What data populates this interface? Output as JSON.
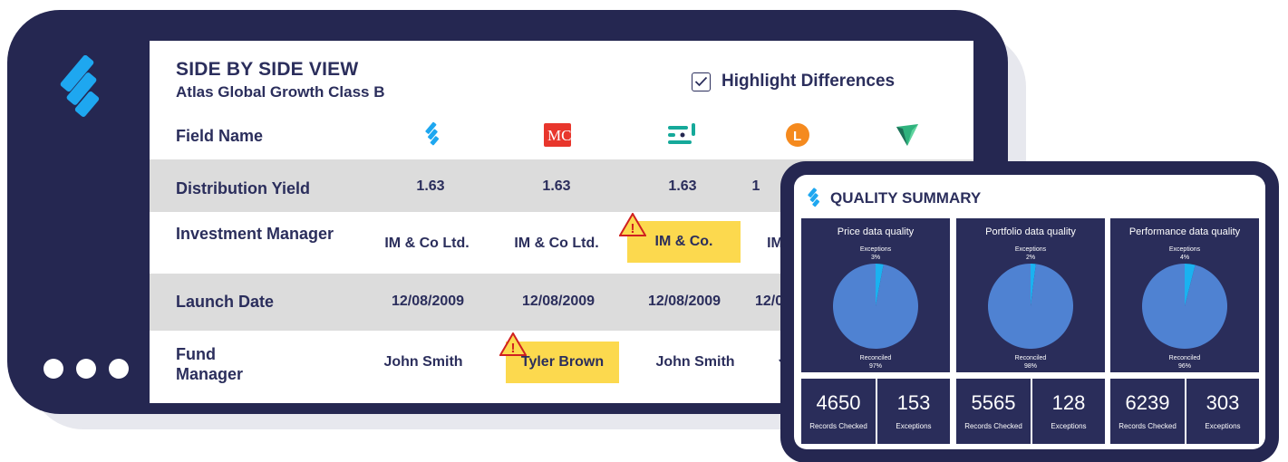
{
  "header": {
    "title": "SIDE BY SIDE VIEW",
    "subtitle": "Atlas Global Growth Class B",
    "highlight_label": "Highlight Differences",
    "highlight_checked": true,
    "field_name_label": "Field Name"
  },
  "sources": [
    {
      "icon": "blue-chevron-logo-icon"
    },
    {
      "icon": "mc-red-logo-icon"
    },
    {
      "icon": "teal-bars-logo-icon"
    },
    {
      "icon": "orange-l-circle-logo-icon"
    },
    {
      "icon": "green-triangle-logo-icon"
    }
  ],
  "rows": [
    {
      "label": "Distribution  Yield",
      "values": [
        "1.63",
        "1.63",
        "1.63",
        "1"
      ]
    },
    {
      "label": "Investment Manager",
      "values": [
        "IM & Co Ltd.",
        "IM & Co Ltd.",
        "IM & Co.",
        "IM"
      ],
      "diff_index": 2
    },
    {
      "label": "Launch Date",
      "values": [
        "12/08/2009",
        "12/08/2009",
        "12/08/2009",
        "12/0"
      ]
    },
    {
      "label": "Fund Manager",
      "values": [
        "John Smith",
        "Tyler Brown",
        "John Smith",
        "J"
      ],
      "diff_index": 1
    }
  ],
  "warning_glyph": "!",
  "quality": {
    "title": "QUALITY SUMMARY",
    "panels": [
      {
        "title": "Price data quality",
        "exceptions_label": "Exceptions",
        "exceptions_pct": "3%",
        "reconciled_label": "Reconciled",
        "reconciled_pct": "97%",
        "records_checked": "4650",
        "records_label": "Records Checked",
        "exceptions_count": "153",
        "exceptions_count_label": "Exceptions"
      },
      {
        "title": "Portfolio data quality",
        "exceptions_label": "Exceptions",
        "exceptions_pct": "2%",
        "reconciled_label": "Reconciled",
        "reconciled_pct": "98%",
        "records_checked": "5565",
        "records_label": "Records Checked",
        "exceptions_count": "128",
        "exceptions_count_label": "Exceptions"
      },
      {
        "title": "Performance data quality",
        "exceptions_label": "Exceptions",
        "exceptions_pct": "4%",
        "reconciled_label": "Reconciled",
        "reconciled_pct": "96%",
        "records_checked": "6239",
        "records_label": "Records Checked",
        "exceptions_count": "303",
        "exceptions_count_label": "Exceptions"
      }
    ]
  },
  "chart_data": [
    {
      "type": "pie",
      "title": "Price data quality",
      "categories": [
        "Exceptions",
        "Reconciled"
      ],
      "values": [
        3,
        97
      ]
    },
    {
      "type": "pie",
      "title": "Portfolio data quality",
      "categories": [
        "Exceptions",
        "Reconciled"
      ],
      "values": [
        2,
        98
      ]
    },
    {
      "type": "pie",
      "title": "Performance data quality",
      "categories": [
        "Exceptions",
        "Reconciled"
      ],
      "values": [
        4,
        96
      ]
    }
  ],
  "colors": {
    "frame": "#252751",
    "text": "#2b2e5c",
    "row_shade": "#dcdcdc",
    "diff_highlight": "#fcd94e",
    "pie_main": "#4f82d2",
    "pie_exception": "#1ab2f0",
    "panel_bg": "#2a2d5a"
  }
}
